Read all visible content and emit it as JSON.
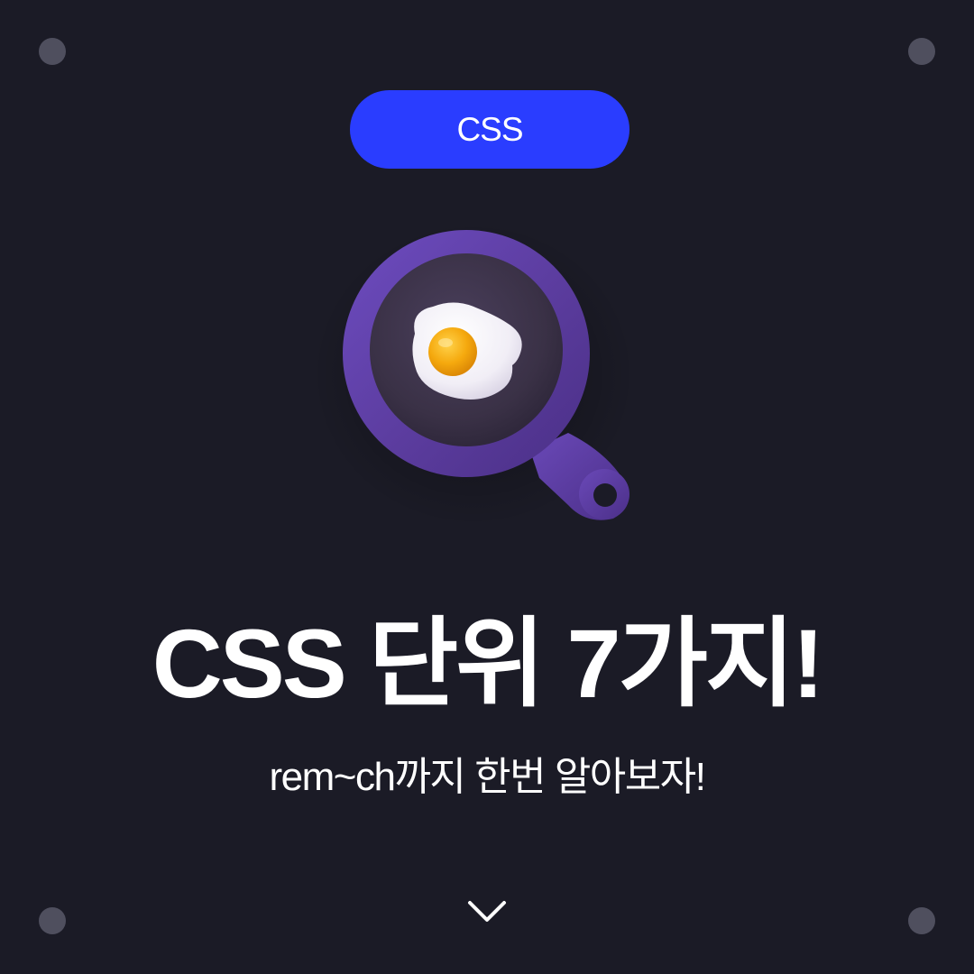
{
  "tag": {
    "label": "CSS",
    "color": "#2a3dff"
  },
  "headline": "CSS 단위 7가지!",
  "subtitle": "rem~ch까지 한번 알아보자!",
  "illustration": {
    "icon": "frying-pan-with-egg-icon"
  },
  "scroll_indicator": {
    "icon": "chevron-down-icon"
  },
  "colors": {
    "background": "#1b1b26",
    "pan": "#5e3fa0",
    "yolk": "#f5a90e",
    "corner_dot": "#4f4f5e"
  }
}
